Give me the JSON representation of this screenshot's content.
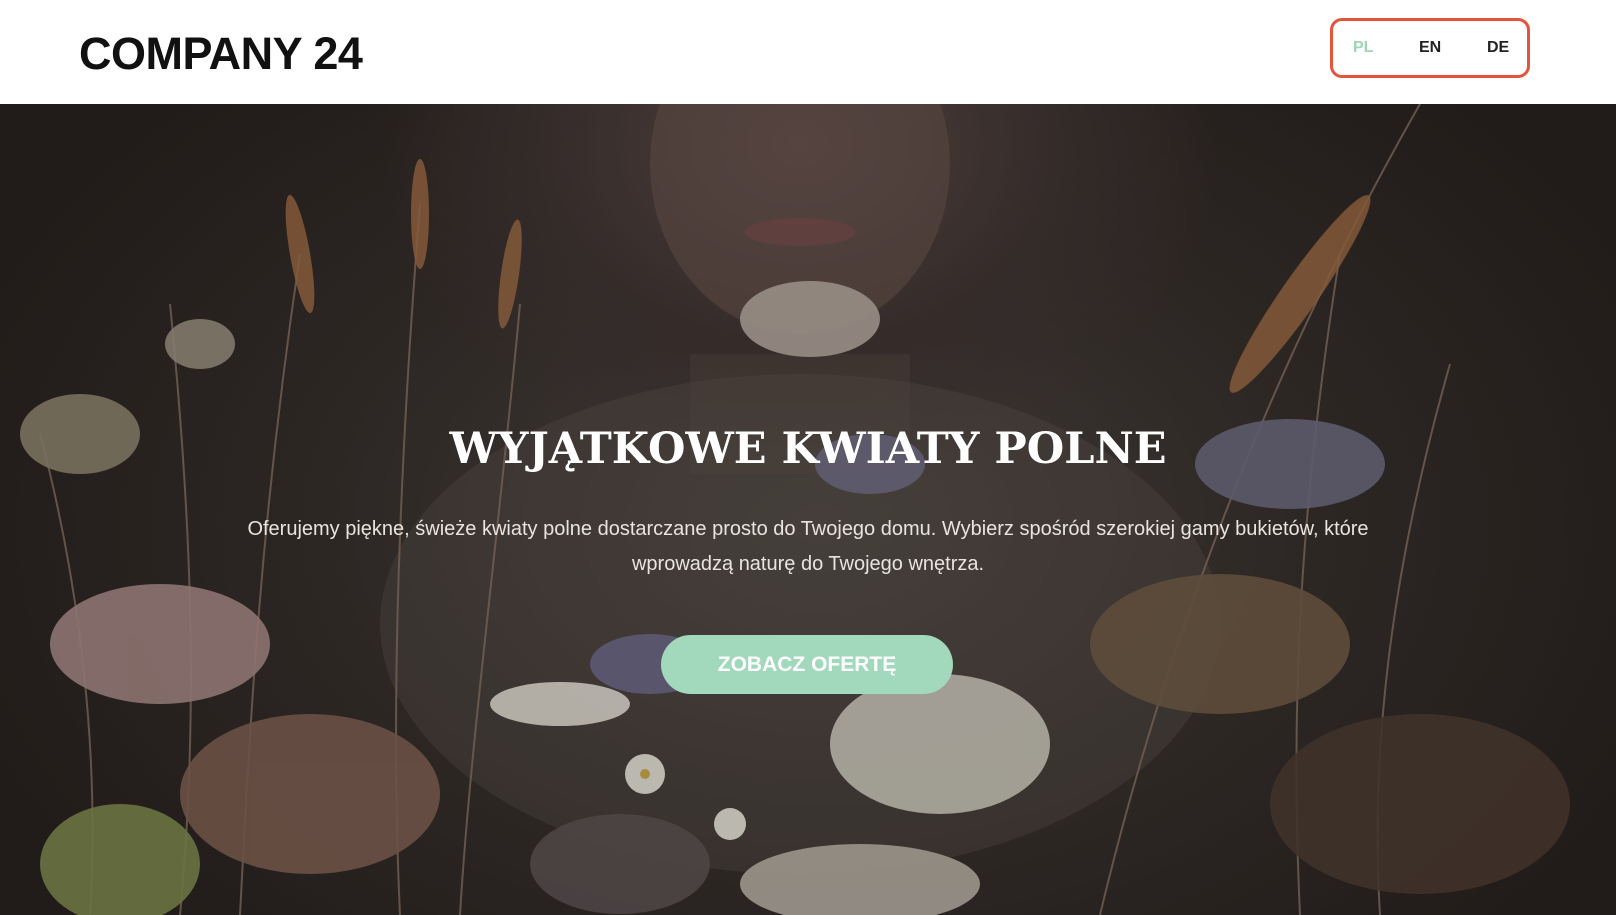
{
  "header": {
    "logo": "COMPANY 24",
    "languages": [
      {
        "code": "PL",
        "active": true
      },
      {
        "code": "EN",
        "active": false
      },
      {
        "code": "DE",
        "active": false
      }
    ]
  },
  "hero": {
    "title": "WYJĄTKOWE KWIATY POLNE",
    "subtitle": "Oferujemy piękne, świeże kwiaty polne dostarczane prosto do Twojego domu. Wybierz spośród szerokiej gamy bukietów, które wprowadzą naturę do Twojego wnętrza.",
    "cta_label": "ZOBACZ OFERTĘ",
    "image_description": "woman-with-wildflowers"
  },
  "colors": {
    "accent": "#a2d8bb",
    "active_lang": "#9dd5b6",
    "highlight_border": "#e2553a",
    "text_dark": "#111111"
  }
}
